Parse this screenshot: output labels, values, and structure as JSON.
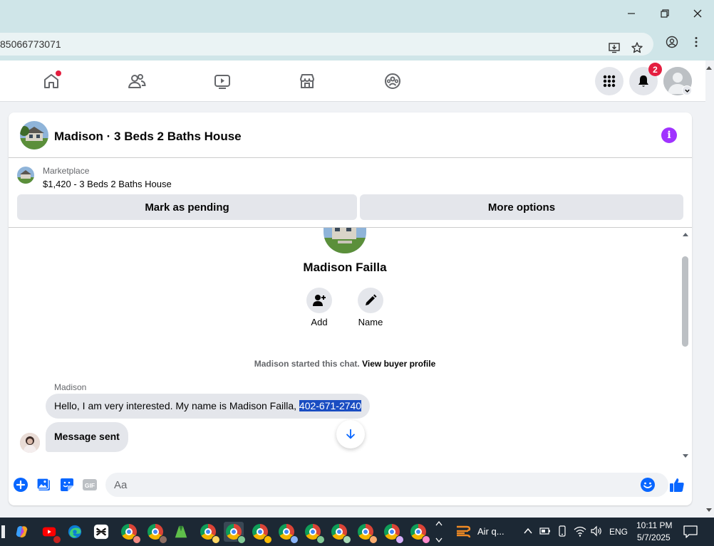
{
  "browser": {
    "url": "85066773071",
    "window_controls": {
      "minimize": "minimize",
      "restore": "restore",
      "close": "close"
    }
  },
  "fb_nav": {
    "items": [
      "home",
      "friends",
      "video",
      "marketplace",
      "groups"
    ],
    "notifications_count": "2"
  },
  "chat": {
    "title": "Madison · 3 Beds 2 Baths House",
    "marketplace_label": "Marketplace",
    "listing_price_title": "$1,420 - 3 Beds 2 Baths House",
    "mark_pending_label": "Mark as pending",
    "more_options_label": "More options",
    "buyer_name": "Madison Failla",
    "actions": [
      {
        "label": "Add"
      },
      {
        "label": "Name"
      }
    ],
    "started_text": "Madison started this chat.",
    "view_profile_label": "View buyer profile",
    "sender_label": "Madison",
    "message1_text": "Hello, I am very interested. My name is Madison Failla, ",
    "message1_phone": "402-671-2740",
    "message2_text": "Message sent",
    "composer_placeholder": "Aa"
  },
  "taskbar": {
    "weather_text": "Air q...",
    "language": "ENG",
    "time": "10:11 PM",
    "date": "5/7/2025"
  },
  "colors": {
    "fb_blue": "#0866ff",
    "badge_red": "#e41e3f",
    "info_purple": "#a033ff",
    "selection_blue": "#1a4dc2"
  }
}
